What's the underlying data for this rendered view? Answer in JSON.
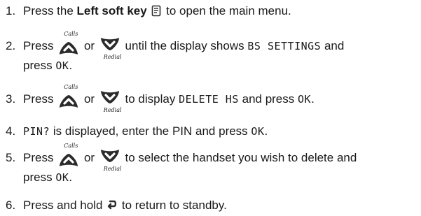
{
  "steps": [
    {
      "number": "1.",
      "text_a": "Press the ",
      "bold": "Left soft key",
      "text_b": " to open the main menu.",
      "icon": "left-soft-key-icon"
    },
    {
      "number": "2.",
      "text_a": "Press",
      "or": "or",
      "text_b": "until the display shows",
      "display": "BS SETTINGS",
      "text_c": "and",
      "text_d": "press",
      "ok": "OK",
      "end": "."
    },
    {
      "number": "3.",
      "text_a": "Press",
      "or": "or",
      "text_b": "to display",
      "display": "DELETE HS",
      "text_c": "and press",
      "ok": "OK",
      "end": "."
    },
    {
      "number": "4.",
      "display": "PIN?",
      "text_a": "is displayed, enter the PIN and press",
      "ok": "OK",
      "end": "."
    },
    {
      "number": "5.",
      "text_a": "Press",
      "or": "or",
      "text_b": "to select the handset you wish to delete and",
      "text_c": "press",
      "ok": "OK",
      "end": "."
    },
    {
      "number": "6.",
      "text_a": "Press and hold",
      "text_b": "to return to standby.",
      "icon": "back-end-key-icon"
    }
  ],
  "key_labels": {
    "up": "Calls",
    "down": "Redial"
  },
  "colors": {
    "text": "#1a1a1a",
    "key_icon": "#2b2b2b"
  }
}
